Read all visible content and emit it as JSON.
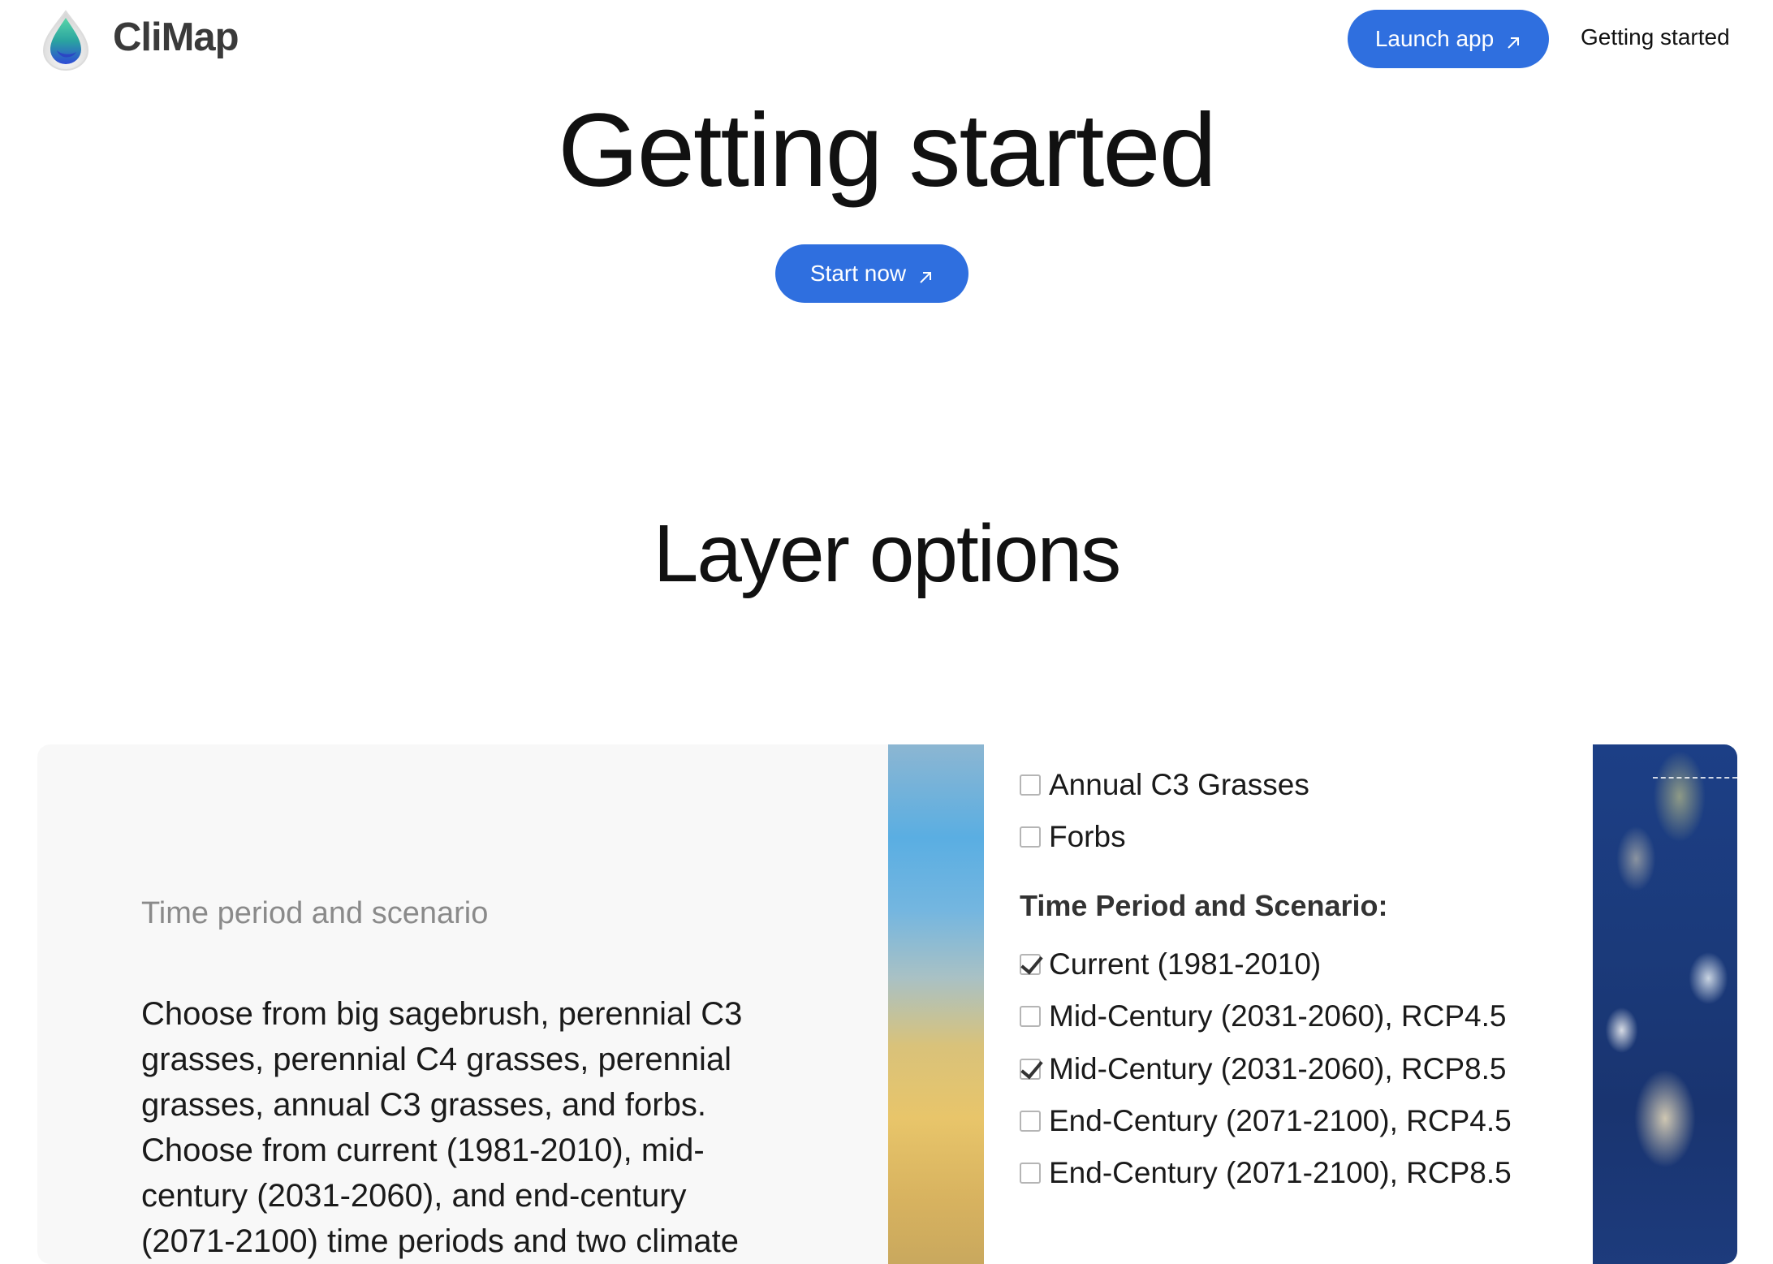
{
  "header": {
    "brand": "CliMap",
    "launch_label": "Launch app",
    "nav_getting_started": "Getting started"
  },
  "hero": {
    "title": "Getting started",
    "start_label": "Start now"
  },
  "section": {
    "title": "Layer options"
  },
  "card": {
    "subtitle": "Time period and scenario",
    "body": "Choose from big sagebrush, perennial C3 grasses, perennial C4 grasses, perennial grasses, annual C3 grasses, and forbs. Choose from current (1981-2010), mid-century (2031-2060), and end-century (2071-2100) time periods and two climate"
  },
  "panel": {
    "vegetation_options": [
      {
        "label": "Annual C3 Grasses",
        "checked": false
      },
      {
        "label": "Forbs",
        "checked": false
      }
    ],
    "time_heading": "Time Period and Scenario:",
    "time_options": [
      {
        "label": "Current (1981-2010)",
        "checked": true
      },
      {
        "label": "Mid-Century (2031-2060), RCP4.5",
        "checked": false
      },
      {
        "label": "Mid-Century (2031-2060), RCP8.5",
        "checked": true
      },
      {
        "label": "End-Century (2071-2100), RCP4.5",
        "checked": false
      },
      {
        "label": "End-Century (2071-2100), RCP8.5",
        "checked": false
      }
    ]
  },
  "colors": {
    "accent": "#2f6fdf",
    "card_bg": "#f8f8f8",
    "subtitle": "#8a8a8a"
  },
  "icons": {
    "logo": "water-drop-logo-icon",
    "external": "arrow-up-right-icon"
  }
}
